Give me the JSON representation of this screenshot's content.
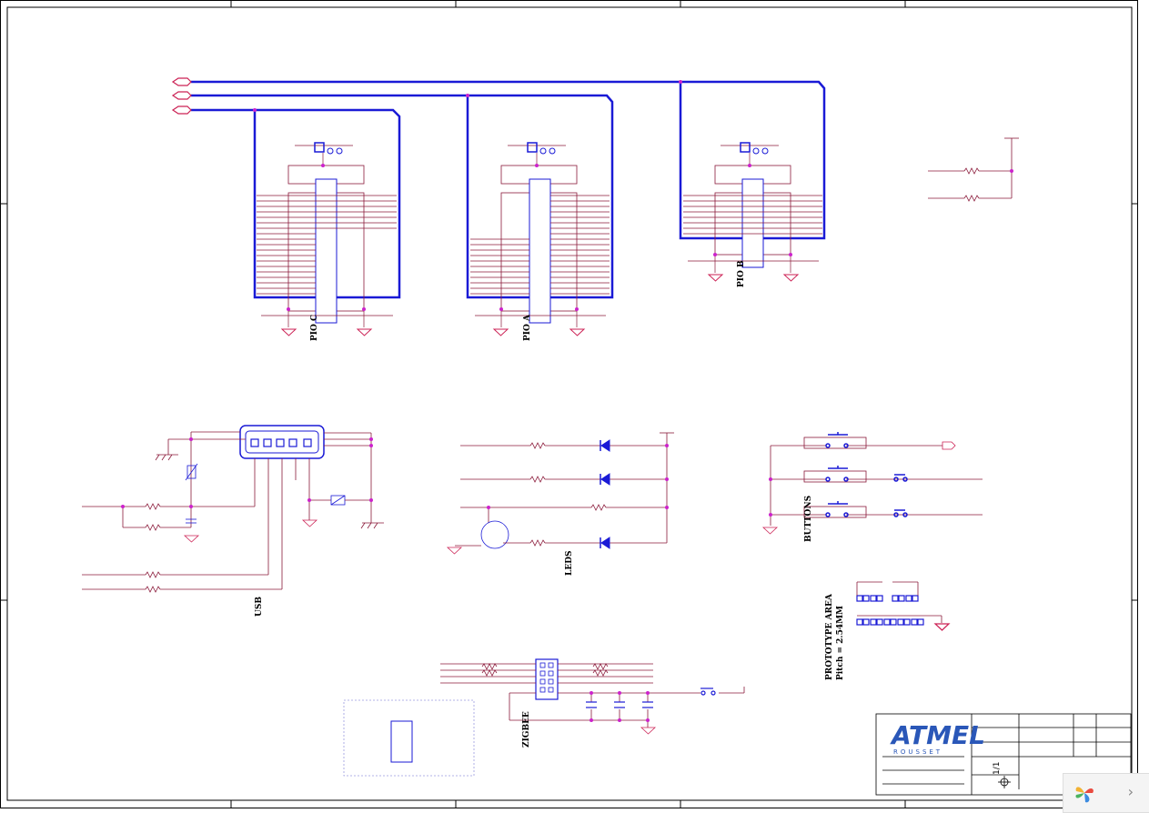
{
  "labels": {
    "pio_c": "PIO C",
    "pio_a": "PIO A",
    "pio_b": "PIO B",
    "usb": "USB",
    "leds": "LEDS",
    "buttons": "BUTTONS",
    "zigbee": "ZIGBEE",
    "prototype_area": "PROTOTYPE AREA",
    "pitch": "Pitch = 2.54MM"
  },
  "title_block": {
    "logo": "ATMEL",
    "logo_sub": "ROUSSET",
    "sheet": "1/1"
  },
  "colors": {
    "bus": "#1a1ad6",
    "wire": "#8b1a3a",
    "component": "#1a1ad6",
    "junction": "#cc22cc",
    "frame": "#000000"
  },
  "icons": {
    "logo": "photos-app-icon",
    "next": "chevron-right-icon"
  }
}
